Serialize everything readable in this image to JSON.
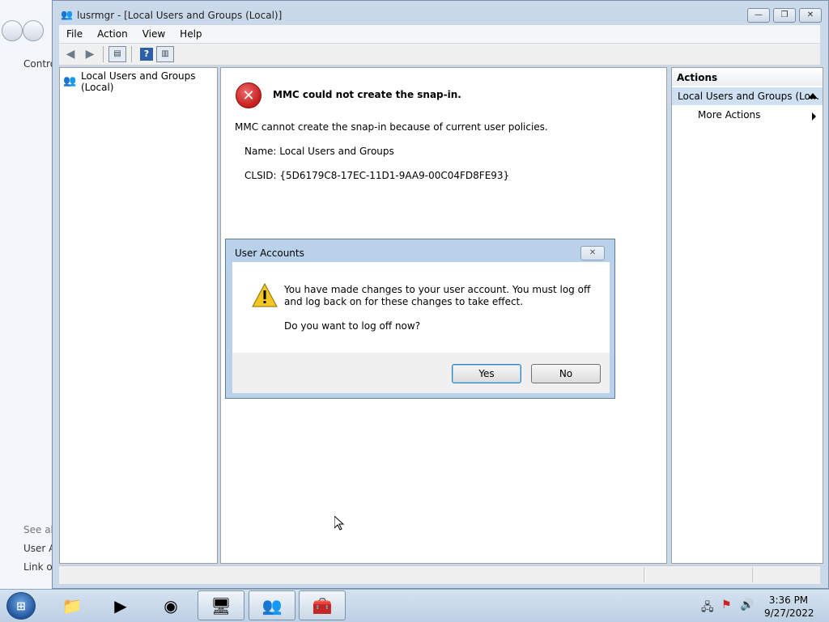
{
  "background": {
    "items": [
      "Contro",
      "See als",
      "User A",
      "Link or"
    ]
  },
  "window": {
    "title": "lusrmgr - [Local Users and Groups (Local)]",
    "buttons": {
      "minimize": "—",
      "restore": "❐",
      "close": "✕"
    }
  },
  "menu": [
    "File",
    "Action",
    "View",
    "Help"
  ],
  "toolbar": {
    "help_label": "?"
  },
  "tree": {
    "root": "Local Users and Groups (Local)"
  },
  "error": {
    "icon": "✕",
    "title": "MMC could not create the snap-in.",
    "message": "MMC cannot create the snap-in because of current user policies.",
    "name": "Name: Local Users and Groups",
    "clsid": "CLSID: {5D6179C8-17EC-11D1-9AA9-00C04FD8FE93}"
  },
  "actions": {
    "header": "Actions",
    "group": "Local Users and Groups (Lo...",
    "item": "More Actions"
  },
  "dialog": {
    "title": "User Accounts",
    "close": "✕",
    "message": "You have made changes to your user account. You must log off and log back on for these changes to take effect.",
    "question": "Do you want to log off now?",
    "yes": "Yes",
    "no": "No"
  },
  "taskbar": {
    "start_label": "⊞",
    "clock_time": "3:36 PM",
    "clock_date": "9/27/2022",
    "apps": [
      "file-explorer",
      "media-player",
      "chrome",
      "control-panel",
      "user-accounts",
      "toolbox"
    ]
  },
  "colors": {
    "title_bar": "#c9d9ea",
    "actions_group": "#cfe0f2",
    "error_red": "#c41d1d",
    "warning_yellow": "#f3c623"
  }
}
